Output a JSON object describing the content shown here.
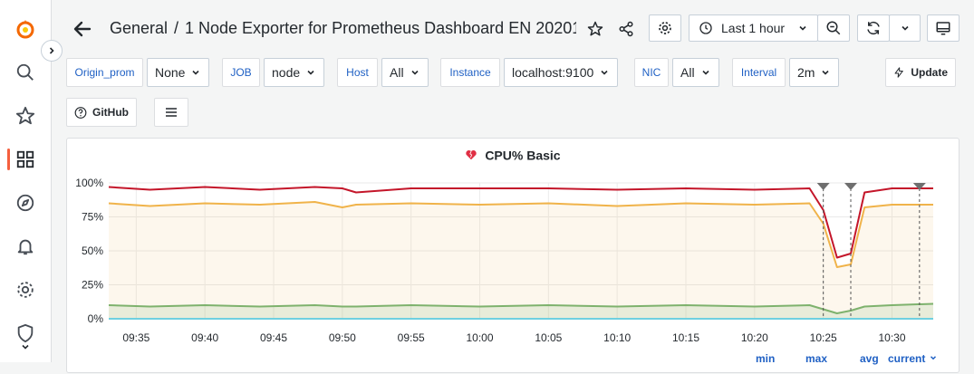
{
  "sidebar": {
    "items": [
      {
        "name": "grafana-logo"
      },
      {
        "name": "search-icon"
      },
      {
        "name": "starred-icon"
      },
      {
        "name": "dashboards-icon"
      },
      {
        "name": "explore-icon"
      },
      {
        "name": "alerting-icon"
      },
      {
        "name": "configuration-icon"
      },
      {
        "name": "server-admin-icon"
      }
    ]
  },
  "header": {
    "folder": "General",
    "separator": "/",
    "title": "1 Node Exporter for Prometheus Dashboard EN 20201…",
    "time_range": "Last 1 hour"
  },
  "variables": [
    {
      "label": "Origin_prom",
      "value": "None"
    },
    {
      "label": "JOB",
      "value": "node"
    },
    {
      "label": "Host",
      "value": "All"
    },
    {
      "label": "Instance",
      "value": "localhost:9100"
    },
    {
      "label": "NIC",
      "value": "All"
    },
    {
      "label": "Interval",
      "value": "2m"
    }
  ],
  "update_label": "Update",
  "github_label": "GitHub",
  "panel": {
    "title": "CPU% Basic",
    "legend_headers": [
      "min",
      "max",
      "avg",
      "current"
    ]
  },
  "chart_data": {
    "type": "line",
    "title": "CPU% Basic",
    "y_ticks": [
      "100%",
      "75%",
      "50%",
      "25%",
      "0%"
    ],
    "ylim": [
      0,
      100
    ],
    "x_ticks": [
      "09:35",
      "09:40",
      "09:45",
      "09:50",
      "09:55",
      "10:00",
      "10:05",
      "10:10",
      "10:15",
      "10:20",
      "10:25",
      "10:30"
    ],
    "x_range": [
      "09:33",
      "10:33"
    ],
    "annotations": [
      "10:25",
      "10:27",
      "10:32"
    ],
    "series": [
      {
        "color": "#c4162a",
        "x": [
          "09:33",
          "09:36",
          "09:40",
          "09:44",
          "09:48",
          "09:50",
          "09:51",
          "09:55",
          "10:00",
          "10:05",
          "10:10",
          "10:15",
          "10:20",
          "10:24",
          "10:25",
          "10:26",
          "10:27",
          "10:28",
          "10:30",
          "10:33"
        ],
        "values": [
          97,
          95,
          97,
          95,
          97,
          96,
          93,
          96,
          96,
          96,
          95,
          96,
          95,
          96,
          80,
          45,
          48,
          93,
          96,
          96
        ]
      },
      {
        "color": "#f0b34a",
        "x": [
          "09:33",
          "09:36",
          "09:40",
          "09:44",
          "09:48",
          "09:50",
          "09:51",
          "09:55",
          "10:00",
          "10:05",
          "10:10",
          "10:15",
          "10:20",
          "10:24",
          "10:25",
          "10:26",
          "10:27",
          "10:28",
          "10:30",
          "10:33"
        ],
        "values": [
          85,
          83,
          85,
          84,
          86,
          82,
          84,
          85,
          84,
          85,
          83,
          85,
          84,
          85,
          70,
          38,
          40,
          82,
          84,
          84
        ]
      },
      {
        "color": "#7eb26d",
        "x": [
          "09:33",
          "09:36",
          "09:40",
          "09:44",
          "09:48",
          "09:50",
          "09:51",
          "09:55",
          "10:00",
          "10:05",
          "10:10",
          "10:15",
          "10:20",
          "10:24",
          "10:25",
          "10:26",
          "10:27",
          "10:28",
          "10:30",
          "10:33"
        ],
        "values": [
          10,
          9,
          10,
          9,
          10,
          9,
          9,
          10,
          9,
          10,
          9,
          10,
          9,
          10,
          7,
          4,
          6,
          9,
          10,
          11
        ]
      },
      {
        "color": "#6ed0e0",
        "x": [
          "09:33",
          "10:33"
        ],
        "values": [
          0,
          0
        ]
      }
    ]
  }
}
